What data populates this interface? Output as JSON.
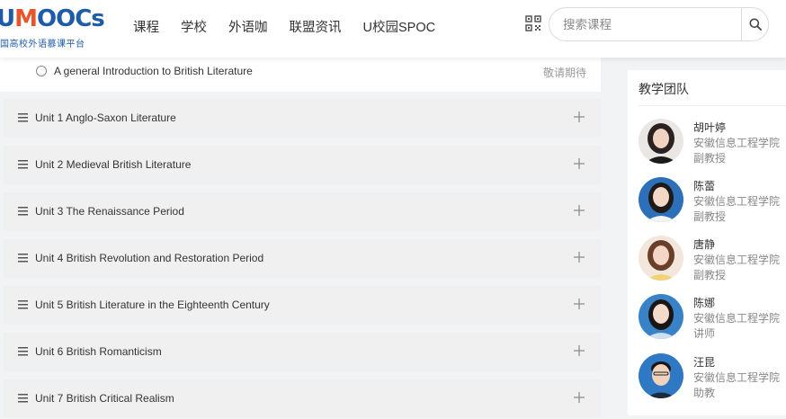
{
  "header": {
    "logo": {
      "u": "U",
      "m": "M",
      "rest": "OOCs",
      "subtitle": "国高校外语慕课平台"
    },
    "nav": [
      "课程",
      "学校",
      "外语咖",
      "联盟资讯",
      "U校园SPOC"
    ],
    "search": {
      "placeholder": "搜索课程",
      "value": ""
    }
  },
  "intro": {
    "title": "A general Introduction to British Literature",
    "status": "敬请期待"
  },
  "units": [
    "Unit 1 Anglo-Saxon Literature",
    "Unit 2 Medieval British Literature",
    "Unit 3 The Renaissance Period",
    "Unit 4 British Revolution and Restoration Period",
    "Unit 5 British Literature in the Eighteenth Century",
    "Unit 6 British Romanticism",
    "Unit 7 British Critical Realism"
  ],
  "sidebar": {
    "title": "教学团队",
    "teachers": [
      {
        "name": "胡叶婷",
        "school": "安徽信息工程学院",
        "title": "副教授"
      },
      {
        "name": "陈蕾",
        "school": "安徽信息工程学院",
        "title": "副教授"
      },
      {
        "name": "唐静",
        "school": "安徽信息工程学院",
        "title": "副教授"
      },
      {
        "name": "陈娜",
        "school": "安徽信息工程学院",
        "title": "讲师"
      },
      {
        "name": "汪昆",
        "school": "安徽信息工程学院",
        "title": "助教"
      }
    ]
  },
  "icons": {
    "qr": "qr-code-icon",
    "search": "search-icon",
    "menu": "list-menu-icon",
    "plus": "plus-icon",
    "radio": "radio-circle-icon"
  },
  "colors": {
    "brand_blue": "#1e5ba8",
    "brand_orange": "#e9542a"
  }
}
